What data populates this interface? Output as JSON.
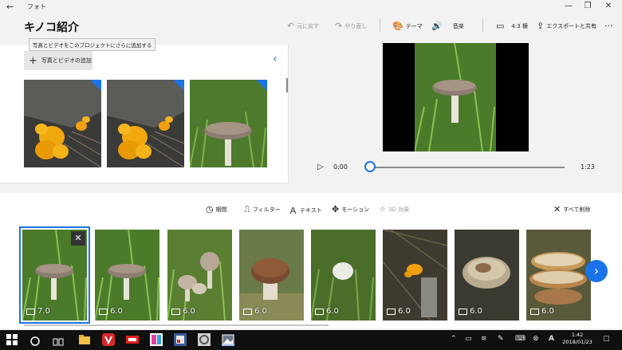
{
  "window": {
    "app_name": "フォト",
    "back_glyph": "←",
    "minimize_glyph": "—",
    "maximize_glyph": "❐",
    "close_glyph": "✕"
  },
  "toolbar": {
    "project_title": "キノコ紹介",
    "undo_label": "元に戻す",
    "redo_label": "やり直し",
    "theme_label": "テーマ",
    "music_label": "音楽",
    "aspect_label": "4:3 横",
    "export_label": "エクスポートと共有",
    "more_glyph": "···"
  },
  "library": {
    "tooltip": "写真とビデオをこのプロジェクトにさらに追加する",
    "add_label": "写真とビデオの追加",
    "collapse_glyph": "‹"
  },
  "player": {
    "current_time": "0:00",
    "end_time": "1:23",
    "progress": 0.0,
    "play_glyph": "▷"
  },
  "storyboard": {
    "tools": {
      "duration": "期間",
      "filter": "フィルター",
      "text": "テキスト",
      "motion": "モーション",
      "effects_3d": "3D 効果",
      "remove_all": "すべて削除"
    },
    "clips": [
      {
        "duration": "7.0",
        "selected": true
      },
      {
        "duration": "6.0"
      },
      {
        "duration": "6.0"
      },
      {
        "duration": "6.0"
      },
      {
        "duration": "6.0"
      },
      {
        "duration": "6.0"
      },
      {
        "duration": "6.0"
      },
      {
        "duration": "6.0"
      }
    ],
    "next_glyph": "›",
    "close_glyph": "✕"
  },
  "taskbar": {
    "time": "1:42",
    "date": "2018/01/23"
  },
  "colors": {
    "accent": "#1a73e8",
    "taskbar": "#101010"
  }
}
